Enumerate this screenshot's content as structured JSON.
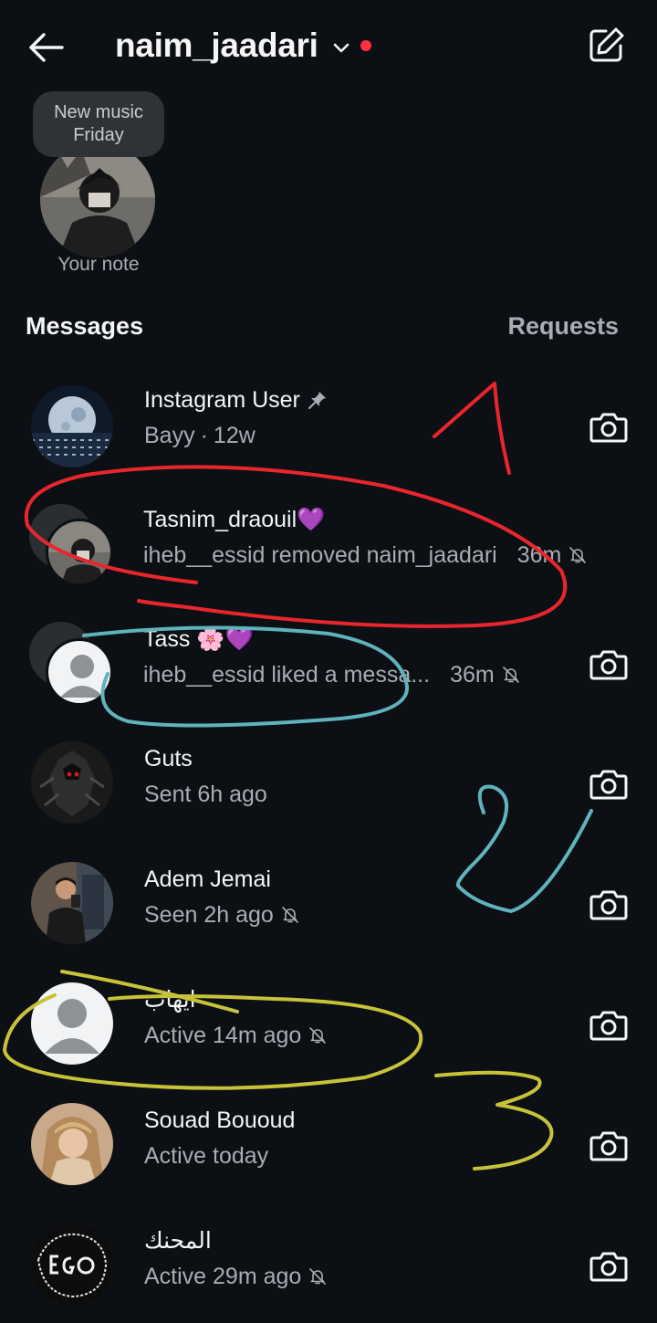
{
  "header": {
    "username": "naim_jaadari",
    "back_icon": "arrow-left-icon",
    "dropdown_icon": "chevron-down-icon",
    "compose_icon": "compose-icon",
    "indicator_color": "#ff3040"
  },
  "note": {
    "bubble_text": "New music Friday",
    "label": "Your note"
  },
  "sections": {
    "messages": "Messages",
    "requests": "Requests"
  },
  "threads": [
    {
      "name": "Instagram User",
      "pinned": true,
      "subtitle": "Bayy",
      "separator": "·",
      "time": "12w",
      "muted": false,
      "camera": true
    },
    {
      "name": "Tasnim_draouil💜",
      "subtitle": "iheb__essid removed naim_jaadari",
      "time": "36m",
      "muted": true,
      "camera": false
    },
    {
      "name": "Tass 🌸💜",
      "subtitle": "iheb__essid liked a messa...",
      "time": "36m",
      "muted": true,
      "camera": true
    },
    {
      "name": "Guts",
      "subtitle": "Sent 6h ago",
      "muted": false,
      "camera": true
    },
    {
      "name": "Adem Jemai",
      "subtitle": "Seen 2h ago",
      "muted": true,
      "camera": true
    },
    {
      "name": "ايهاب",
      "subtitle": "Active 14m ago",
      "muted": true,
      "camera": true
    },
    {
      "name": "Souad Bououd",
      "subtitle": "Active today",
      "muted": false,
      "camera": true
    },
    {
      "name": "المحنك",
      "subtitle": "Active 29m ago",
      "muted": true,
      "camera": true
    }
  ],
  "colors": {
    "background": "#0c1014",
    "primary_text": "#f5f5f5",
    "secondary_text": "#a8adb3",
    "annotation_red": "#e8262c",
    "annotation_blue": "#5fb3bd",
    "annotation_yellow": "#c8c23a"
  }
}
